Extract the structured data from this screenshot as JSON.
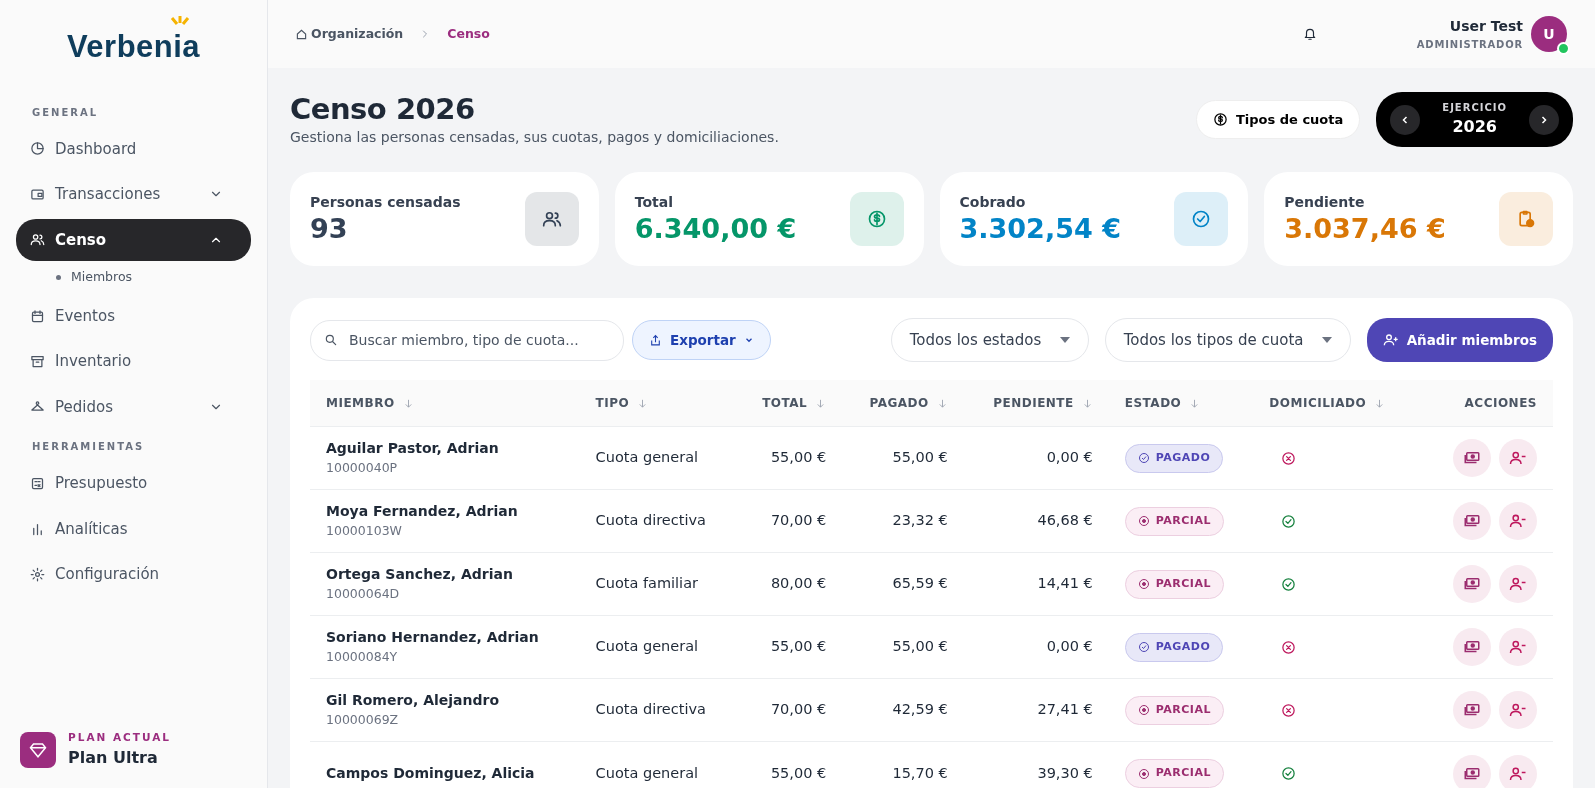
{
  "brand": {
    "name": "Verbenia"
  },
  "sidebar": {
    "sections": [
      {
        "heading": "GENERAL",
        "items": [
          {
            "label": "Dashboard",
            "selected": false
          },
          {
            "label": "Transacciones",
            "selected": false,
            "expanded": false
          },
          {
            "label": "Censo",
            "selected": true,
            "expanded": true,
            "children": [
              {
                "label": "Miembros"
              }
            ]
          },
          {
            "label": "Eventos",
            "selected": false
          },
          {
            "label": "Inventario",
            "selected": false
          },
          {
            "label": "Pedidos",
            "selected": false,
            "expanded": false
          }
        ]
      },
      {
        "heading": "HERRAMIENTAS",
        "items": [
          {
            "label": "Presupuesto",
            "selected": false
          },
          {
            "label": "Analíticas",
            "selected": false
          },
          {
            "label": "Configuración",
            "selected": false
          }
        ]
      }
    ],
    "plan": {
      "caption": "PLAN ACTUAL",
      "name": "Plan Ultra"
    }
  },
  "breadcrumb": [
    {
      "label": "Organización",
      "selected": false
    },
    {
      "label": "Censo",
      "selected": true
    }
  ],
  "user": {
    "name": "User Test",
    "role": "ADMINISTRADOR",
    "initial": "U",
    "online": true
  },
  "page": {
    "title": "Censo 2026",
    "subtitle": "Gestiona las personas censadas, sus cuotas, pagos y domiciliaciones.",
    "fee_types_button": "Tipos de cuota",
    "year_caption": "EJERCICIO",
    "year": "2026"
  },
  "stats": [
    {
      "label": "Personas censadas",
      "value": "93",
      "color": "#334155"
    },
    {
      "label": "Total",
      "value": "6.340,00 €",
      "color": "#059669"
    },
    {
      "label": "Cobrado",
      "value": "3.302,54 €",
      "color": "#0284c7"
    },
    {
      "label": "Pendiente",
      "value": "3.037,46 €",
      "color": "#d97706"
    }
  ],
  "toolbar": {
    "search_placeholder": "Buscar miembro, tipo de cuota...",
    "export_button": "Exportar",
    "status_filter": "Todos los estados",
    "type_filter": "Todos los tipos de cuota",
    "add_button": "Añadir miembros"
  },
  "table": {
    "columns": [
      {
        "label": "MIEMBRO",
        "sortable": true
      },
      {
        "label": "TIPO",
        "sortable": true
      },
      {
        "label": "TOTAL",
        "sortable": true
      },
      {
        "label": "PAGADO",
        "sortable": true
      },
      {
        "label": "PENDIENTE",
        "sortable": true
      },
      {
        "label": "ESTADO",
        "sortable": true
      },
      {
        "label": "DOMICILIADO",
        "sortable": true
      },
      {
        "label": "ACCIONES",
        "sortable": false
      }
    ],
    "rows": [
      {
        "name": "Aguilar Pastor, Adrian",
        "id": "10000040P",
        "type": "Cuota general",
        "total": "55,00 €",
        "paid": "55,00 €",
        "pending": "0,00 €",
        "status": {
          "kind": "pagado",
          "label": "PAGADO"
        },
        "direct_debit": false
      },
      {
        "name": "Moya Fernandez, Adrian",
        "id": "10000103W",
        "type": "Cuota directiva",
        "total": "70,00 €",
        "paid": "23,32 €",
        "pending": "46,68 €",
        "status": {
          "kind": "parcial",
          "label": "PARCIAL"
        },
        "direct_debit": true
      },
      {
        "name": "Ortega Sanchez, Adrian",
        "id": "10000064D",
        "type": "Cuota familiar",
        "total": "80,00 €",
        "paid": "65,59 €",
        "pending": "14,41 €",
        "status": {
          "kind": "parcial",
          "label": "PARCIAL"
        },
        "direct_debit": true
      },
      {
        "name": "Soriano Hernandez, Adrian",
        "id": "10000084Y",
        "type": "Cuota general",
        "total": "55,00 €",
        "paid": "55,00 €",
        "pending": "0,00 €",
        "status": {
          "kind": "pagado",
          "label": "PAGADO"
        },
        "direct_debit": false
      },
      {
        "name": "Gil Romero, Alejandro",
        "id": "10000069Z",
        "type": "Cuota directiva",
        "total": "70,00 €",
        "paid": "42,59 €",
        "pending": "27,41 €",
        "status": {
          "kind": "parcial",
          "label": "PARCIAL"
        },
        "direct_debit": false
      },
      {
        "name": "Campos Dominguez, Alicia",
        "type": "Cuota general",
        "total": "55,00 €",
        "paid": "15,70 €",
        "pending": "39,30 €",
        "status": {
          "kind": "parcial",
          "label": "PARCIAL"
        },
        "direct_debit": true
      }
    ]
  }
}
